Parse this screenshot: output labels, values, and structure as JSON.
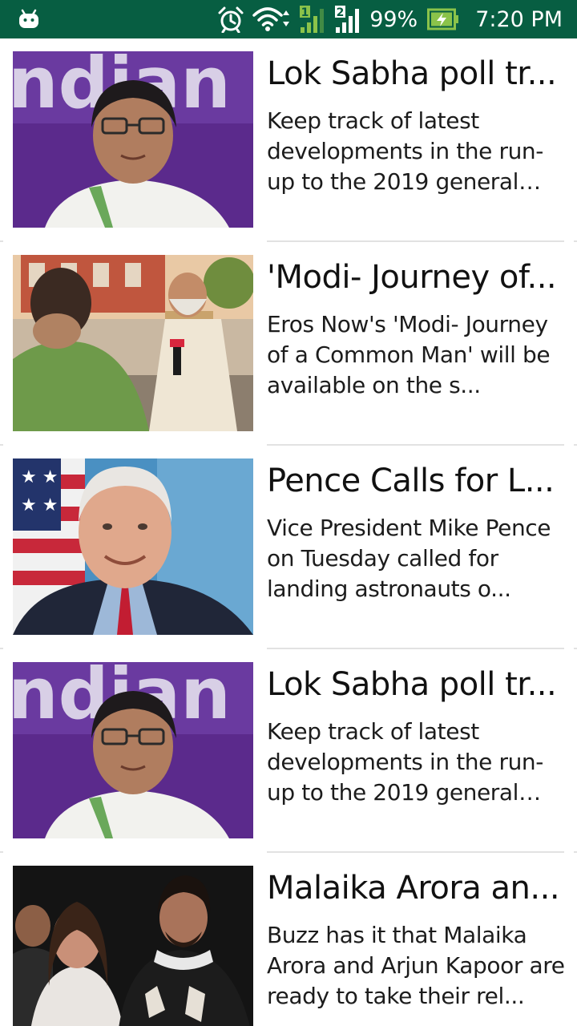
{
  "status_bar": {
    "battery": "99%",
    "time": "7:20 PM",
    "sim1": "1",
    "sim2": "2",
    "icons": [
      "android-icon",
      "alarm-icon",
      "wifi-icon",
      "signal-sim1-icon",
      "signal-sim2-icon",
      "battery-charging-icon"
    ]
  },
  "feed": {
    "items": [
      {
        "headline": "Lok Sabha poll tr...",
        "snippet": "Keep track of latest developments in the run-up to the 2019 general el...",
        "image": "mamata-banerjee-photo"
      },
      {
        "headline": "'Modi- Journey of...",
        "snippet": "Eros Now's 'Modi- Journey of a Common Man' will be available on the s...",
        "image": "modi-journey-photo"
      },
      {
        "headline": "Pence Calls for L...",
        "snippet": "Vice President Mike Pence on Tuesday called for landing astronauts o...",
        "image": "mike-pence-photo"
      },
      {
        "headline": "Lok Sabha poll tr...",
        "snippet": "Keep track of latest developments in the run-up to the 2019 general el...",
        "image": "mamata-banerjee-photo"
      },
      {
        "headline": "Malaika Arora an...",
        "snippet": "Buzz has it that Malaika Arora and Arjun Kapoor are ready to take their rel...",
        "image": "malaika-arjun-photo"
      }
    ]
  },
  "colors": {
    "status_bar_bg": "#075e42",
    "battery_green": "#8bc34a",
    "sim1_green": "#8bc34a",
    "divider": "#e2e2e2"
  }
}
